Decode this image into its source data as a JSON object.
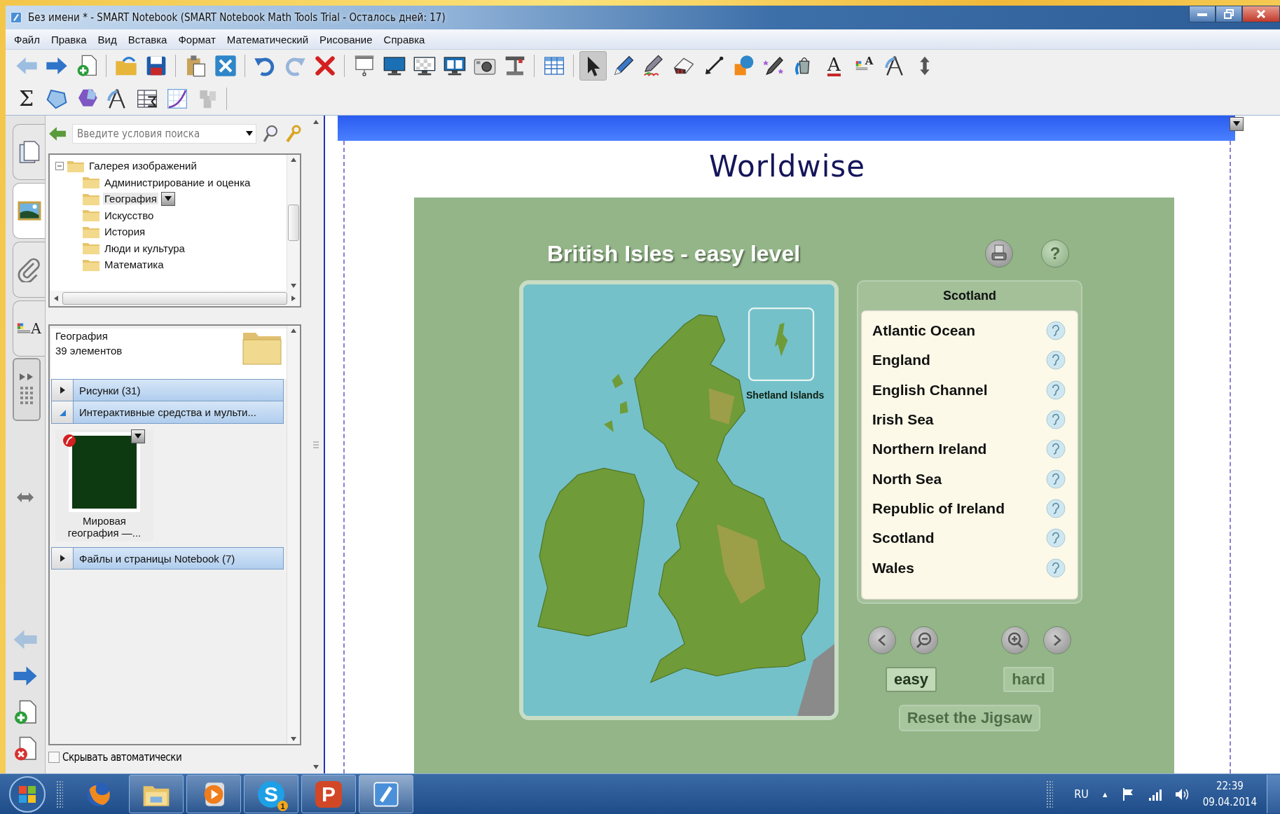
{
  "window": {
    "title": "Без имени * - SMART Notebook (SMART Notebook Math Tools Trial - Осталось дней: 17)"
  },
  "menu": [
    "Файл",
    "Правка",
    "Вид",
    "Вставка",
    "Формат",
    "Математический",
    "Рисование",
    "Справка"
  ],
  "toolbar_row_1": [
    {
      "kind": "back",
      "selected": false,
      "disabled": true
    },
    {
      "kind": "forward",
      "selected": false,
      "disabled": false
    },
    {
      "kind": "add-page",
      "selected": false,
      "disabled": false
    },
    {
      "kind": "separator"
    },
    {
      "kind": "open",
      "selected": false,
      "disabled": false
    },
    {
      "kind": "save",
      "selected": false,
      "disabled": false
    },
    {
      "kind": "separator"
    },
    {
      "kind": "paste",
      "selected": false,
      "disabled": false
    },
    {
      "kind": "clear",
      "selected": false,
      "disabled": false
    },
    {
      "kind": "separator"
    },
    {
      "kind": "undo",
      "selected": false,
      "disabled": false
    },
    {
      "kind": "redo",
      "selected": false,
      "disabled": true
    },
    {
      "kind": "delete",
      "selected": false,
      "disabled": false
    },
    {
      "kind": "separator"
    },
    {
      "kind": "screen-shade",
      "selected": false,
      "disabled": false
    },
    {
      "kind": "full-screen",
      "selected": false,
      "disabled": false
    },
    {
      "kind": "transparent",
      "selected": false,
      "disabled": false
    },
    {
      "kind": "dual-page",
      "selected": false,
      "disabled": false
    },
    {
      "kind": "capture",
      "selected": false,
      "disabled": false
    },
    {
      "kind": "document-camera",
      "selected": false,
      "disabled": false
    },
    {
      "kind": "separator"
    },
    {
      "kind": "table",
      "selected": false,
      "disabled": false
    },
    {
      "kind": "separator"
    },
    {
      "kind": "select",
      "selected": true,
      "disabled": false
    },
    {
      "kind": "pen",
      "selected": false,
      "disabled": false
    },
    {
      "kind": "creative-pen",
      "selected": false,
      "disabled": false
    },
    {
      "kind": "eraser",
      "selected": false,
      "disabled": false
    },
    {
      "kind": "line",
      "selected": false,
      "disabled": false
    },
    {
      "kind": "shapes",
      "selected": false,
      "disabled": false
    },
    {
      "kind": "magic-pen",
      "selected": false,
      "disabled": false
    },
    {
      "kind": "fill",
      "selected": false,
      "disabled": false
    },
    {
      "kind": "text",
      "glyph": "A",
      "selected": false,
      "disabled": false
    },
    {
      "kind": "properties",
      "glyph": "A",
      "selected": false,
      "disabled": false
    },
    {
      "kind": "compass",
      "selected": false,
      "disabled": false
    },
    {
      "kind": "move",
      "selected": false,
      "disabled": false
    }
  ],
  "toolbar_row_2": [
    {
      "kind": "sigma",
      "glyph": "Σ",
      "selected": false,
      "disabled": false
    },
    {
      "kind": "polygon",
      "selected": false,
      "disabled": false
    },
    {
      "kind": "regular-shapes",
      "selected": false,
      "disabled": false
    },
    {
      "kind": "compass",
      "selected": false,
      "disabled": false
    },
    {
      "kind": "table-sum",
      "selected": false,
      "disabled": false
    },
    {
      "kind": "graph",
      "selected": false,
      "disabled": false
    },
    {
      "kind": "tools",
      "selected": false,
      "disabled": true
    },
    {
      "kind": "separator"
    }
  ],
  "side_tabs": [
    {
      "kind": "pages",
      "selected": false
    },
    {
      "kind": "gallery",
      "selected": true
    },
    {
      "kind": "attachments",
      "selected": false
    },
    {
      "kind": "properties",
      "glyph": "A",
      "selected": false
    }
  ],
  "page_nav": [
    {
      "kind": "previous",
      "disabled": true
    },
    {
      "kind": "next",
      "disabled": false
    },
    {
      "kind": "add",
      "disabled": false
    },
    {
      "kind": "delete",
      "disabled": false
    }
  ],
  "gallery": {
    "search": {
      "placeholder": "Введите условия поиска"
    },
    "tree": [
      {
        "label": "Галерея изображений",
        "expanded": true,
        "selected": false,
        "children": [
          {
            "label": "Администрирование и оценка",
            "selected": false
          },
          {
            "label": "География",
            "selected": true
          },
          {
            "label": "Искусство",
            "selected": false
          },
          {
            "label": "История",
            "selected": false
          },
          {
            "label": "Люди и культура",
            "selected": false
          },
          {
            "label": "Математика",
            "selected": false
          }
        ]
      }
    ],
    "folder": {
      "name": "География",
      "count": "39 элементов"
    },
    "sections": [
      {
        "label": "Рисунки (31)",
        "expanded": false
      },
      {
        "label": "Интерактивные средства и мульти...",
        "expanded": true,
        "items": [
          {
            "caption": "Мировая география —..."
          }
        ]
      },
      {
        "label": "Файлы и страницы Notebook (7)",
        "expanded": false
      }
    ],
    "auto_hide": {
      "label": "Скрывать автоматически",
      "checked": false
    }
  },
  "page": {
    "title": "Worldwise",
    "activity": {
      "title": "British Isles - easy level",
      "help": "?",
      "map_label": "Shetland Islands",
      "list_heading": "Scotland",
      "places": [
        "Atlantic Ocean",
        "England",
        "English Channel",
        "Irish Sea",
        "Northern Ireland",
        "North Sea",
        "Republic of Ireland",
        "Scotland",
        "Wales"
      ],
      "levels": [
        {
          "label": "easy",
          "selected": true
        },
        {
          "label": "hard",
          "selected": false
        }
      ],
      "reset": "Reset the Jigsaw"
    }
  },
  "taskbar": {
    "apps": [
      {
        "kind": "browser",
        "running": false,
        "active": false
      },
      {
        "kind": "explorer",
        "running": true,
        "active": false
      },
      {
        "kind": "media",
        "running": true,
        "active": false
      },
      {
        "kind": "skype",
        "glyph": "S",
        "badge": "1",
        "running": true,
        "active": false
      },
      {
        "kind": "presentation",
        "glyph": "P",
        "running": true,
        "active": false
      },
      {
        "kind": "notebook",
        "running": true,
        "active": true
      }
    ],
    "language": "RU",
    "tray_toggle": "▲",
    "time": "22:39",
    "date": "09.04.2014"
  }
}
